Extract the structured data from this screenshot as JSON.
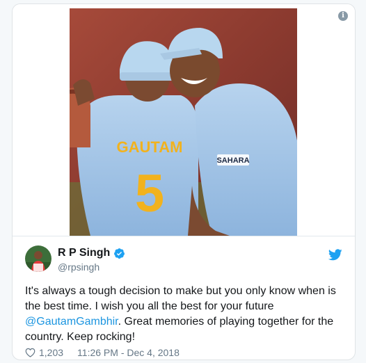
{
  "tweet": {
    "display_name": "R P Singh",
    "handle": "@rpsingh",
    "text_before": "It's always a tough decision to make but you only know when is the best time. I wish you all the best for your future ",
    "mention": "@GautamGambhir",
    "text_after": ". Great memories of playing together for the country. Keep rocking!",
    "likes": "1,203",
    "timestamp": "11:26 PM - Dec 4, 2018"
  },
  "photo": {
    "jersey_name": "GAUTAM",
    "jersey_number": "5",
    "sponsor": "SAHARA"
  },
  "icons": {
    "info": "info-icon",
    "verified": "verified-badge-icon",
    "bird": "twitter-bird-icon",
    "heart": "heart-icon"
  },
  "colors": {
    "link": "#1b95e0",
    "secondary_text": "#657786",
    "primary_text": "#14171a",
    "jersey": "#9ec3e6",
    "jersey_number": "#f2b21d"
  }
}
